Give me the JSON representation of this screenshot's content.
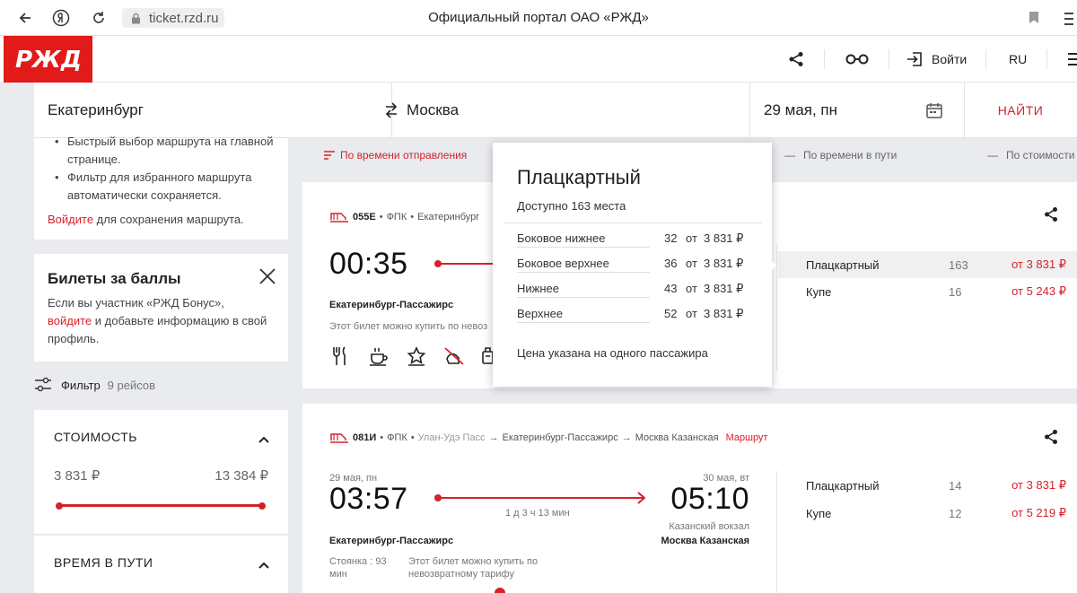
{
  "browser": {
    "url": "ticket.rzd.ru",
    "title": "Официальный портал ОАО «РЖД»"
  },
  "header": {
    "logo_text": "РЖД",
    "login": "Войти",
    "lang": "RU"
  },
  "search": {
    "from": "Екатеринбург",
    "to": "Москва",
    "date": "29 мая, пн",
    "find": "НАЙТИ"
  },
  "left": {
    "tips": [
      "Быстрый выбор маршрута на главной странице.",
      "Фильтр для избранного маршрута автоматически сохраняется."
    ],
    "login_link": "Войдите",
    "login_suffix": " для сохранения маршрута.",
    "bonus_title": "Билеты за баллы",
    "bonus_text_1": "Если вы участник «РЖД Бонус»,",
    "bonus_link": "войдите",
    "bonus_text_2": " и добавьте информацию в свой профиль.",
    "filter_label": "Фильтр",
    "filter_count": "9 рейсов",
    "cost_title": "СТОИМОСТЬ",
    "cost_min": "3 831 ₽",
    "cost_max": "13 384 ₽",
    "time_title": "ВРЕМЯ В ПУТИ"
  },
  "sort": {
    "departure": "По времени отправления",
    "travel": "По времени в пути",
    "cost": "По стоимости"
  },
  "train1": {
    "number": "055Е",
    "carrier": "ФПК",
    "route": "Екатеринбург",
    "dep_time": "00:35",
    "dep_station": "Екатеринбург-Пассажирс",
    "note": "Этот билет можно купить по невоз",
    "classes": [
      {
        "name": "Плацкартный",
        "count": "163",
        "price": "от 3 831 ₽"
      },
      {
        "name": "Купе",
        "count": "16",
        "price": "от 5 243 ₽"
      }
    ]
  },
  "popup": {
    "title": "Плацкартный",
    "available": "Доступно 163 места",
    "rows": [
      {
        "name": "Боковое нижнее",
        "count": "32",
        "from": "от",
        "price": "3 831 ₽"
      },
      {
        "name": "Боковое верхнее",
        "count": "36",
        "from": "от",
        "price": "3 831 ₽"
      },
      {
        "name": "Нижнее",
        "count": "43",
        "from": "от",
        "price": "3 831 ₽"
      },
      {
        "name": "Верхнее",
        "count": "52",
        "from": "от",
        "price": "3 831 ₽"
      }
    ],
    "footer": "Цена указана на одного пассажира"
  },
  "train2": {
    "number": "081И",
    "carrier": "ФПК",
    "origin": "Улан-Удэ Пасс",
    "route_mid": "Екатеринбург-Пассажирс",
    "route_end": "Москва Казанская",
    "route_link": "Маршрут",
    "dep_date": "29 мая, пн",
    "dep_time": "03:57",
    "duration": "1 д 3 ч 13 мин",
    "arr_date": "30 мая, вт",
    "arr_time": "05:10",
    "arr_terminal": "Казанский вокзал",
    "dep_station": "Екатеринбург-Пассажирс",
    "arr_station": "Москва Казанская",
    "stop": "Стоянка : 93 мин",
    "note": "Этот билет можно купить по невозвратному тарифу",
    "classes": [
      {
        "name": "Плацкартный",
        "count": "14",
        "price": "от 3 831 ₽"
      },
      {
        "name": "Купе",
        "count": "12",
        "price": "от 5 219 ₽"
      }
    ]
  }
}
